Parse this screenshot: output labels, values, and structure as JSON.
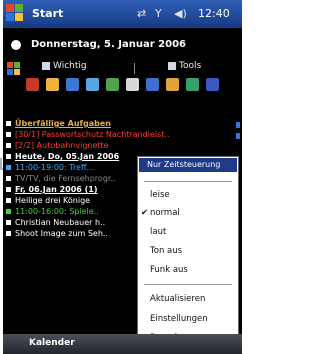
{
  "window": {
    "title": "Start",
    "clock": "12:40",
    "status_icons": [
      "connectivity-icon",
      "signal-icon",
      "volume-icon"
    ]
  },
  "today": {
    "date": "Donnerstag, 5. Januar 2006"
  },
  "tabs": [
    {
      "label": "Wichtig",
      "icon": "star-icon"
    },
    {
      "label": "Tools",
      "icon": "tools-icon"
    }
  ],
  "app_icons": [
    "#c43b2c",
    "#f0b43a",
    "#3a78d6",
    "#5ba4e6",
    "#4fa14a",
    "#d8d8d8",
    "#3c6fd0",
    "#e0a23b",
    "#2fa36a",
    "#3b58c2"
  ],
  "tasks": [
    {
      "text": "Überfällige Aufgaben",
      "kind": "header",
      "color": "#e0b24a"
    },
    {
      "text": "[30/1] Passwortschutz Nachtrandleist..",
      "kind": "overdue",
      "color": "#ff3b2f"
    },
    {
      "text": "[2/2] Autobahnvignette",
      "kind": "overdue",
      "color": "#ff3b2f"
    },
    {
      "text": "Heute, Do, 05.Jan 2006",
      "kind": "header",
      "color": "#ffffff"
    },
    {
      "text": "11:00-19:00: Treff...",
      "kind": "appointment",
      "color": "#38a8ff"
    },
    {
      "text": "TV/TV, die Fernsehprogr..",
      "kind": "item",
      "color": "#8a8a8a"
    },
    {
      "text": "Fr, 06.Jan 2006 (1)",
      "kind": "header",
      "color": "#ffffff"
    },
    {
      "text": "Heilige drei Könige",
      "kind": "item",
      "color": "#ffffff"
    },
    {
      "text": "11:00-16:00: Spiele..",
      "kind": "appointment",
      "color": "#3fd13b"
    },
    {
      "text": "Christian Neubauer h..",
      "kind": "item",
      "color": "#ffffff"
    },
    {
      "text": "Shoot Image zum Seh..",
      "kind": "item",
      "color": "#ffffff"
    }
  ],
  "menu": {
    "title": "Nur Zeitsteuerung",
    "items": [
      {
        "label": "leise",
        "checked": false
      },
      {
        "label": "normal",
        "checked": true
      },
      {
        "label": "laut",
        "checked": false
      },
      {
        "label": "Ton aus",
        "checked": false
      },
      {
        "label": "Funk aus",
        "checked": false
      },
      {
        "label": "Aktualisieren",
        "checked": false
      },
      {
        "label": "Einstellungen",
        "checked": false
      },
      {
        "label": "Beenden",
        "checked": false
      }
    ],
    "check_glyph": "✔"
  },
  "softkey": {
    "left": "Kalender"
  }
}
